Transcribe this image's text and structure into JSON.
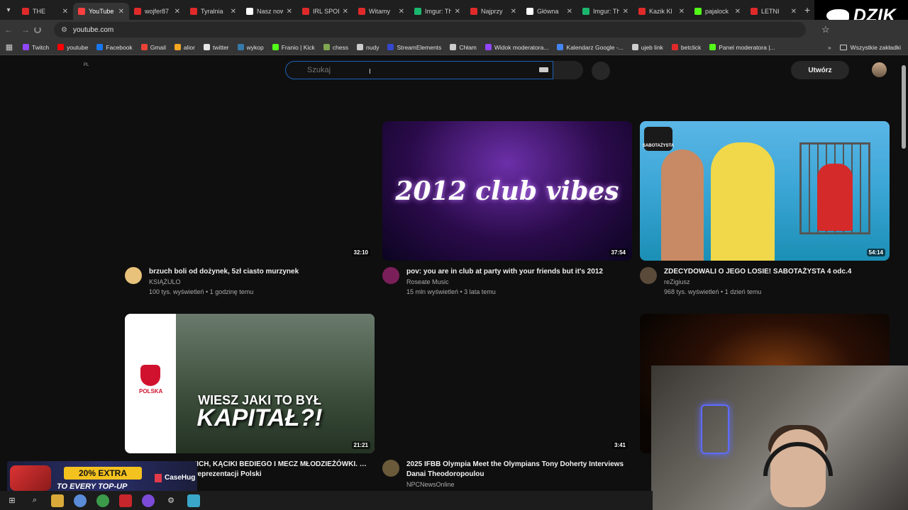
{
  "tabs": [
    {
      "label": "THE",
      "color": "#e02a2a"
    },
    {
      "label": "YouTube",
      "color": "#ff4040",
      "active": true
    },
    {
      "label": "wojfer87",
      "color": "#e02a2a"
    },
    {
      "label": "Tyralnia",
      "color": "#e02a2a"
    },
    {
      "label": "Nasz now",
      "color": "#ffffff"
    },
    {
      "label": "IRL SPOI",
      "color": "#e02a2a"
    },
    {
      "label": "Witamy",
      "color": "#e02a2a"
    },
    {
      "label": "Imgur: Th",
      "color": "#1bb76e"
    },
    {
      "label": "Najprzy",
      "color": "#e02a2a"
    },
    {
      "label": "Główna",
      "color": "#ffffff"
    },
    {
      "label": "Imgur: Th",
      "color": "#1bb76e"
    },
    {
      "label": "Kazik Kl",
      "color": "#e02a2a"
    },
    {
      "label": "pajalock",
      "color": "#53fc18"
    },
    {
      "label": "LETNI",
      "color": "#e02a2a"
    }
  ],
  "brand_overlay": {
    "text": "DZIK"
  },
  "address": {
    "url": "youtube.com"
  },
  "bookmarks": [
    {
      "label": "Twitch",
      "color": "#9146ff"
    },
    {
      "label": "youtube",
      "color": "#ff0000"
    },
    {
      "label": "Facebook",
      "color": "#1877f2"
    },
    {
      "label": "Gmail",
      "color": "#ea4335"
    },
    {
      "label": "alior",
      "color": "#f5a623"
    },
    {
      "label": "twitter",
      "color": "#e6e6e6"
    },
    {
      "label": "wykop",
      "color": "#367aa9"
    },
    {
      "label": "Franio | Kick",
      "color": "#53fc18"
    },
    {
      "label": "chess",
      "color": "#7fa650"
    },
    {
      "label": "nudy",
      "color": "#cccccc"
    },
    {
      "label": "StreamElements",
      "color": "#3447d1"
    },
    {
      "label": "Chłam",
      "color": "#cccccc"
    },
    {
      "label": "Widok moderatora...",
      "color": "#9146ff"
    },
    {
      "label": "Kalendarz Google -...",
      "color": "#4285f4"
    },
    {
      "label": "ujeb link",
      "color": "#cccccc"
    },
    {
      "label": "betclick",
      "color": "#e02a2a"
    },
    {
      "label": "Panel moderatora |...",
      "color": "#53fc18"
    }
  ],
  "bookmarks_all": "Wszystkie zakładki",
  "yt": {
    "region": "PL",
    "search_placeholder": "Szukaj",
    "create": "Utwórz"
  },
  "videos": [
    {
      "title": "brzuch boli od dożynek, 5zł ciasto murzynek",
      "channel": "KSIĄŻULO",
      "stats": "100 tys. wyświetleń • 1 godzinę temu",
      "duration": "32:10",
      "avatar": "#e8c27a"
    },
    {
      "title": "pov: you are in club at party with your friends but it's 2012",
      "channel": "Roseate Music",
      "stats": "15 mln wyświetleń • 3 lata temu",
      "duration": "37:54",
      "avatar": "#7a1f5a",
      "thumb_text": "2012 club vibes"
    },
    {
      "title": "ZDECYDOWALI O JEGO LOSIE! SABOTAŻYSTA 4 odc.4",
      "channel": "reZigiusz",
      "stats": "968 tys. wyświetleń • 1 dzień temu",
      "duration": "54:14",
      "avatar": "#5a4a3a",
      "thumb_text": "SABOTAŻYSTA"
    },
    {
      "title": "…ZAL KIEDZKICH, KĄCIKI BEDIEGO I MECZ MŁODZIEŻÓWKI. …wnego piątku reprezentacji Polski",
      "duration": "21:21",
      "avatar": "#d0122e",
      "thumb_text1": "WIESZ JAKI TO BYŁ",
      "thumb_text2": "KAPITAŁ?!",
      "thumb_brand": "POLSKA"
    },
    {
      "title": "2025 IFBB Olympia Meet the Olympians Tony Doherty Interviews Danai Theodoropoulou",
      "channel": "NPCNewsOnline",
      "duration": "3:41",
      "avatar": "#6a5a3a"
    },
    {
      "duration": "",
      "avatar": "#777"
    }
  ],
  "promo": {
    "line1": "20% EXTRA",
    "line2": "TO EVERY TOP-UP",
    "brand": "CaseHug"
  }
}
